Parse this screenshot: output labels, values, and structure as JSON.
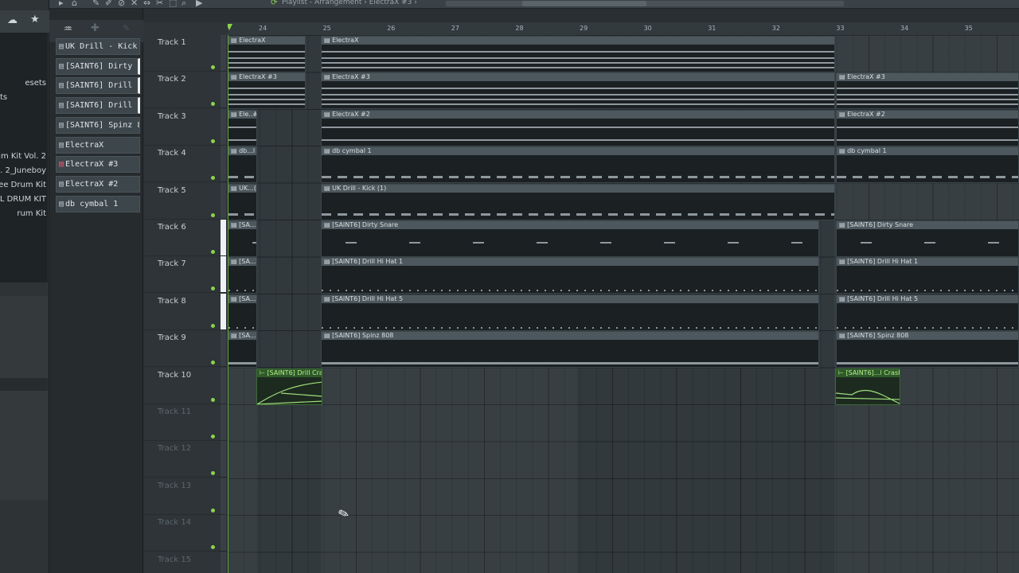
{
  "toolbar": {
    "title": "Playlist - Arrangement › ElectraX #3 ›",
    "icons": [
      "arrow-icon",
      "home-icon",
      "pencil-icon",
      "paint-icon",
      "delete-icon",
      "mute-icon",
      "slip-icon",
      "slice-icon",
      "select-icon",
      "zoom-icon",
      "play-icon"
    ]
  },
  "left_browser": {
    "items": [
      "esets",
      "ts",
      "rum Kit Vol. 2",
      "ol. 2_Juneboy",
      "ee Drum Kit",
      "ILL DRUM KIT",
      "rum Kit"
    ]
  },
  "picker": {
    "items": [
      {
        "label": "UK Drill - Kick (1)",
        "glyph": "▤",
        "selected": false,
        "red": false
      },
      {
        "label": "[SAINT6] Dirty Snare",
        "glyph": "▤",
        "selected": true,
        "red": false
      },
      {
        "label": "[SAINT6] Drill Hi Hat 1",
        "glyph": "▤",
        "selected": true,
        "red": false
      },
      {
        "label": "[SAINT6] Drill Hi Hat 5",
        "glyph": "▤",
        "selected": true,
        "red": false
      },
      {
        "label": "[SAINT6] Spinz 808",
        "glyph": "▤",
        "selected": false,
        "red": false
      },
      {
        "label": "ElectraX",
        "glyph": "▤",
        "selected": false,
        "red": false
      },
      {
        "label": "ElectraX #3",
        "glyph": "▤",
        "selected": false,
        "red": true
      },
      {
        "label": "ElectraX #2",
        "glyph": "▤",
        "selected": false,
        "red": false
      },
      {
        "label": "db cymbal 1",
        "glyph": "▤",
        "selected": false,
        "red": false
      }
    ]
  },
  "ruler": {
    "bars": [
      "24",
      "25",
      "26",
      "27",
      "28",
      "29",
      "30",
      "31",
      "32",
      "33",
      "34",
      "35"
    ]
  },
  "tracks": [
    {
      "name": "Track 1",
      "empty": false
    },
    {
      "name": "Track 2",
      "empty": false
    },
    {
      "name": "Track 3",
      "empty": false
    },
    {
      "name": "Track 4",
      "empty": false
    },
    {
      "name": "Track 5",
      "empty": false
    },
    {
      "name": "Track 6",
      "empty": false
    },
    {
      "name": "Track 7",
      "empty": false
    },
    {
      "name": "Track 8",
      "empty": false
    },
    {
      "name": "Track 9",
      "empty": false
    },
    {
      "name": "Track 10",
      "empty": false
    },
    {
      "name": "Track 11",
      "empty": true
    },
    {
      "name": "Track 12",
      "empty": true
    },
    {
      "name": "Track 13",
      "empty": true
    },
    {
      "name": "Track 14",
      "empty": true
    },
    {
      "name": "Track 15",
      "empty": true
    }
  ],
  "clips": [
    {
      "track": 1,
      "label": "ElectraX",
      "pattern": "pat-a",
      "kind": "pattern"
    },
    {
      "track": 1,
      "label": "ElectraX",
      "pattern": "pat-a",
      "kind": "pattern"
    },
    {
      "track": 2,
      "label": "ElectraX #3",
      "pattern": "pat-a",
      "kind": "pattern"
    },
    {
      "track": 2,
      "label": "ElectraX #3",
      "pattern": "pat-a",
      "kind": "pattern"
    },
    {
      "track": 2,
      "label": "ElectraX #3",
      "pattern": "pat-a",
      "kind": "pattern"
    },
    {
      "track": 3,
      "label": "Ele..#2",
      "pattern": "pat-line",
      "kind": "pattern"
    },
    {
      "track": 3,
      "label": "ElectraX #2",
      "pattern": "pat-line",
      "kind": "pattern"
    },
    {
      "track": 3,
      "label": "ElectraX #2",
      "pattern": "pat-line",
      "kind": "pattern"
    },
    {
      "track": 4,
      "label": "db...l 1",
      "pattern": "pat-dash",
      "kind": "pattern"
    },
    {
      "track": 4,
      "label": "db cymbal 1",
      "pattern": "pat-dash",
      "kind": "pattern"
    },
    {
      "track": 4,
      "label": "db cymbal 1",
      "pattern": "pat-dash",
      "kind": "pattern"
    },
    {
      "track": 5,
      "label": "UK...(1)",
      "pattern": "pat-dash",
      "kind": "pattern"
    },
    {
      "track": 5,
      "label": "UK Drill - Kick (1)",
      "pattern": "pat-dash",
      "kind": "pattern"
    },
    {
      "track": 6,
      "label": "[SA...re",
      "pattern": "pat-sparse",
      "kind": "pattern"
    },
    {
      "track": 6,
      "label": "[SAINT6] Dirty Snare",
      "pattern": "pat-sparse",
      "kind": "pattern"
    },
    {
      "track": 6,
      "label": "[SAINT6] Dirty Snare",
      "pattern": "pat-sparse",
      "kind": "pattern"
    },
    {
      "track": 7,
      "label": "[SA...t 1",
      "pattern": "pat-dot",
      "kind": "pattern"
    },
    {
      "track": 7,
      "label": "[SAINT6] Drill Hi Hat 1",
      "pattern": "pat-dot",
      "kind": "pattern"
    },
    {
      "track": 7,
      "label": "[SAINT6] Drill Hi Hat 1",
      "pattern": "pat-dot",
      "kind": "pattern"
    },
    {
      "track": 8,
      "label": "[SA...t 5",
      "pattern": "pat-dot",
      "kind": "pattern"
    },
    {
      "track": 8,
      "label": "[SAINT6] Drill Hi Hat 5",
      "pattern": "pat-dot",
      "kind": "pattern"
    },
    {
      "track": 8,
      "label": "[SAINT6] Drill Hi Hat 5",
      "pattern": "pat-dot",
      "kind": "pattern"
    },
    {
      "track": 9,
      "label": "[SA...08",
      "pattern": "pat-bass",
      "kind": "pattern"
    },
    {
      "track": 9,
      "label": "[SAINT6] Spinz 808",
      "pattern": "pat-bass",
      "kind": "pattern"
    },
    {
      "track": 9,
      "label": "[SAINT6] Spinz 808",
      "pattern": "pat-bass",
      "kind": "pattern"
    },
    {
      "track": 10,
      "label": "[SAINT6] Drill Crash",
      "pattern": "",
      "kind": "audio"
    },
    {
      "track": 10,
      "label": "[SAINT6]...l Crash #3",
      "pattern": "",
      "kind": "audio"
    }
  ]
}
